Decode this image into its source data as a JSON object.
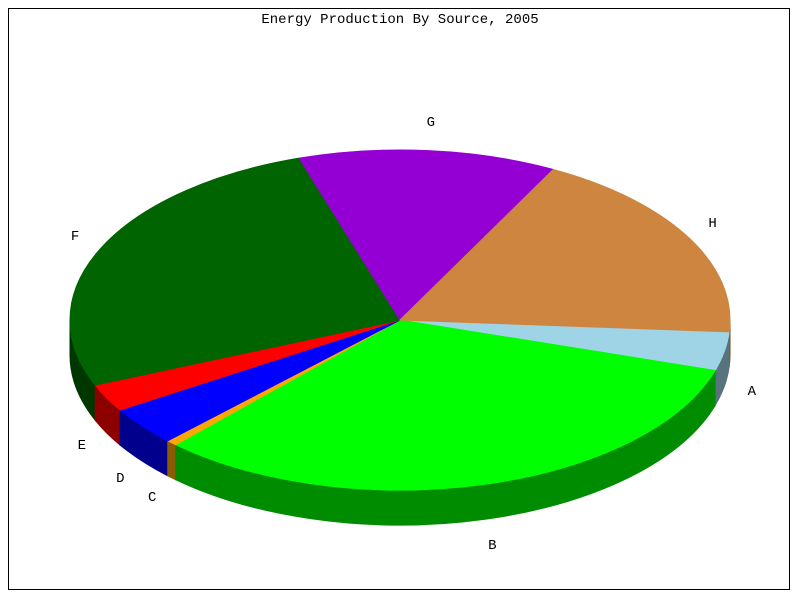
{
  "title": "Energy Production By Source, 2005",
  "chart_data": {
    "type": "pie",
    "title": "Energy Production By Source, 2005",
    "categories": [
      "A",
      "B",
      "C",
      "D",
      "E",
      "F",
      "G",
      "H"
    ],
    "values": [
      3.5,
      30.5,
      0.5,
      3.5,
      2.5,
      25.0,
      12.0,
      17.5
    ],
    "colors": [
      "#9fd4e6",
      "#00ff00",
      "#ffa500",
      "#0000ff",
      "#ff0000",
      "#006400",
      "#9400d3",
      "#cd853f"
    ],
    "start_angle_deg": 4
  },
  "labels": {
    "A": "A",
    "B": "B",
    "C": "C",
    "D": "D",
    "E": "E",
    "F": "F",
    "G": "G",
    "H": "H"
  }
}
